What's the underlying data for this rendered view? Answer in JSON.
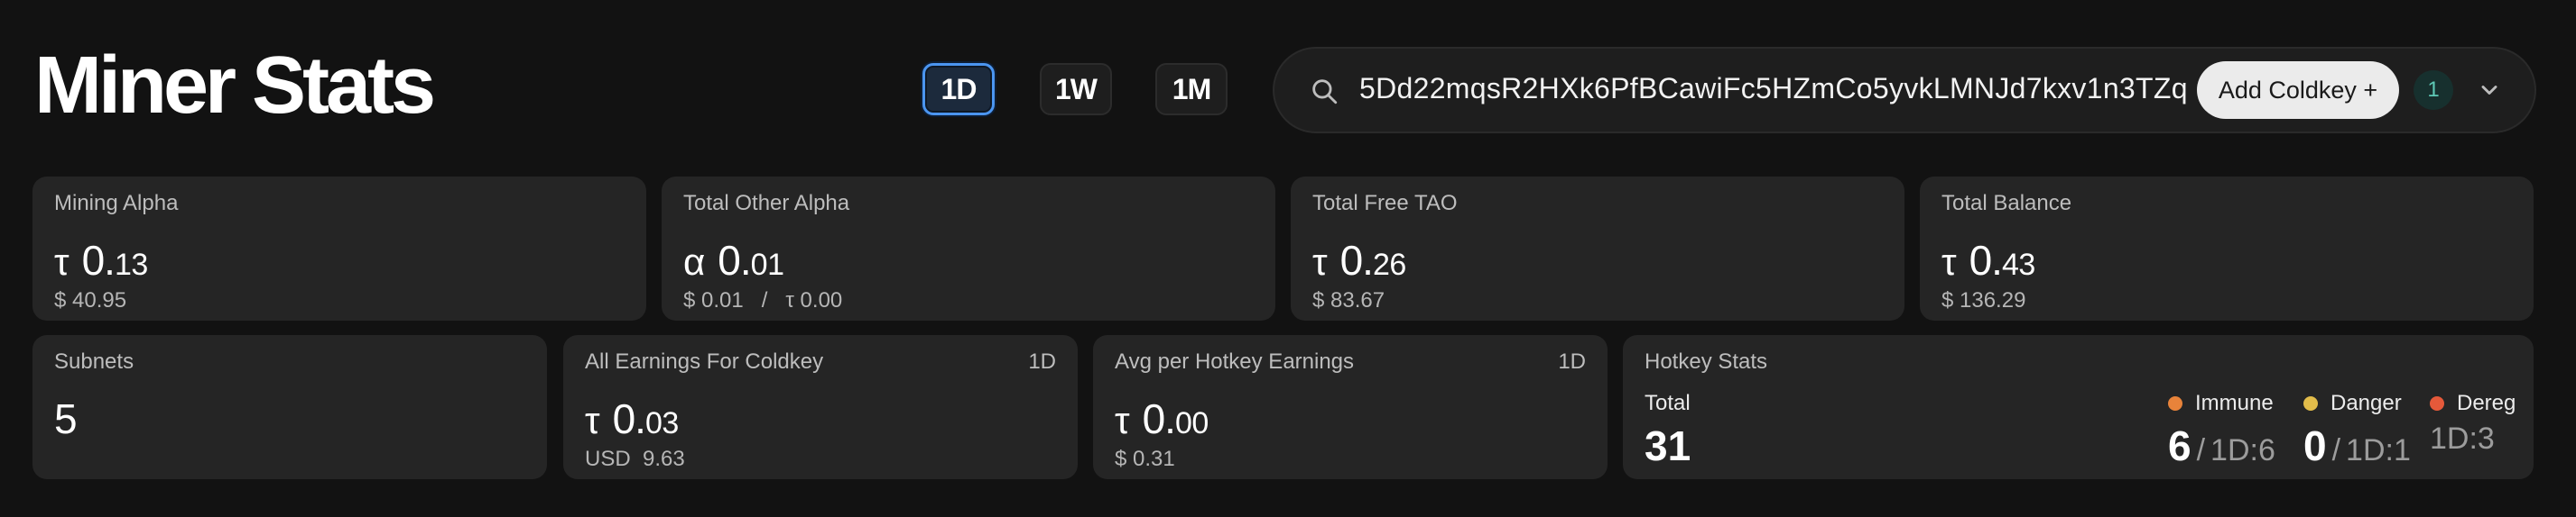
{
  "page": {
    "title": "Miner Stats"
  },
  "range": {
    "options": [
      "1D",
      "1W",
      "1M"
    ],
    "selected": "1D"
  },
  "search": {
    "value": "5Dd22mqsR2HXk6PfBCawiFc5HZmCo5yvkLMNJd7kxv1n3TZq",
    "add_label": "Add Coldkey +",
    "count": "1"
  },
  "cards": {
    "mining_alpha": {
      "label": "Mining Alpha",
      "symbol": "τ",
      "int": "0.",
      "dec": "13",
      "sub": "$ 40.95"
    },
    "total_other_alpha": {
      "label": "Total Other Alpha",
      "symbol": "α",
      "int": "0.",
      "dec": "01",
      "sub": "$ 0.01   /   τ 0.00"
    },
    "total_free_tao": {
      "label": "Total Free TAO",
      "symbol": "τ",
      "int": "0.",
      "dec": "26",
      "sub": "$ 83.67"
    },
    "total_balance": {
      "label": "Total Balance",
      "symbol": "τ",
      "int": "0.",
      "dec": "43",
      "sub": "$ 136.29"
    },
    "subnets": {
      "label": "Subnets",
      "value": "5"
    },
    "all_earnings": {
      "label": "All Earnings For Coldkey",
      "period": "1D",
      "symbol": "τ",
      "int": "0.",
      "dec": "03",
      "sub": "USD  9.63"
    },
    "avg_hotkey": {
      "label": "Avg per Hotkey Earnings",
      "period": "1D",
      "symbol": "τ",
      "int": "0.",
      "dec": "00",
      "sub": "$ 0.31"
    },
    "hotkey_stats": {
      "label": "Hotkey Stats",
      "total_label": "Total",
      "total_value": "31",
      "immune": {
        "label": "Immune",
        "value": "6",
        "period": "1D:6",
        "color": "#e8833a"
      },
      "danger": {
        "label": "Danger",
        "value": "0",
        "period": "1D:1",
        "color": "#e2bc4a"
      },
      "dereg": {
        "label": "Dereg",
        "period": "1D:3",
        "color": "#e5593a"
      }
    }
  }
}
